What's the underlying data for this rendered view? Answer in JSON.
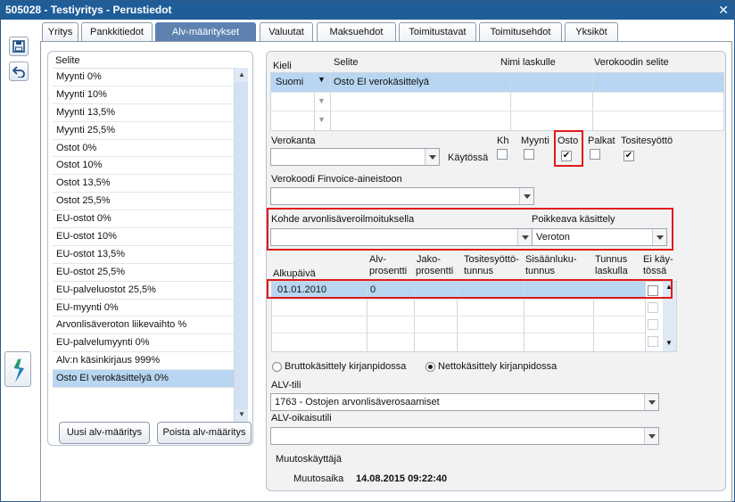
{
  "window": {
    "title": "505028 - Testiyritys - Perustiedot",
    "close_glyph": "✕"
  },
  "toolbar": {
    "save_icon": "save-icon",
    "undo_icon": "undo-icon",
    "app_icon": "app-logo-icon"
  },
  "tabs": [
    {
      "label": "Yritys"
    },
    {
      "label": "Pankkitiedot"
    },
    {
      "label": "Alv-määritykset",
      "active": true
    },
    {
      "label": "Valuutat"
    },
    {
      "label": "Maksuehdot"
    },
    {
      "label": "Toimitustavat"
    },
    {
      "label": "Toimitusehdot"
    },
    {
      "label": "Yksiköt"
    }
  ],
  "list": {
    "header": "Selite",
    "items": [
      "Myynti 0%",
      "Myynti 10%",
      "Myynti 13,5%",
      "Myynti 25,5%",
      "Ostot 0%",
      "Ostot 10%",
      "Ostot 13,5%",
      "Ostot 25,5%",
      "EU-ostot 0%",
      "EU-ostot 10%",
      "EU-ostot 13,5%",
      "EU-ostot 25,5%",
      "EU-palveluostot 25,5%",
      "EU-myynti 0%",
      "Arvonlisäveroton liikevaihto %",
      "EU-palvelumyynti 0%",
      "Alv:n käsinkirjaus 999%",
      "Osto EI verokäsittelyä 0%"
    ],
    "selected_index": 17
  },
  "buttons": {
    "new": "Uusi alv-määritys",
    "delete": "Poista alv-määritys"
  },
  "lang_grid": {
    "headers": {
      "kieli": "Kieli",
      "selite": "Selite",
      "nimi": "Nimi laskulle",
      "verokoodin": "Verokoodin selite"
    },
    "row": {
      "kieli": "Suomi",
      "selite": "Osto EI verokäsittelyä"
    }
  },
  "verokanta": {
    "label": "Verokanta",
    "value": "",
    "kaytossa": "Käytössä"
  },
  "flags": {
    "kh": {
      "label": "Kh",
      "checked": false
    },
    "myynti": {
      "label": "Myynti",
      "checked": false
    },
    "osto": {
      "label": "Osto",
      "checked": true
    },
    "palkat": {
      "label": "Palkat",
      "checked": false
    },
    "tositesyotto": {
      "label": "Tositesyöttö",
      "checked": true
    }
  },
  "finvoice": {
    "label": "Verokoodi Finvoice-aineistoon",
    "value": ""
  },
  "kohde": {
    "label": "Kohde arvonlisäveroilmoituksella",
    "value": ""
  },
  "poikkeava": {
    "label": "Poikkeava käsittely",
    "value": "Veroton"
  },
  "rate_grid": {
    "headers": {
      "alkupaiva": "Alkupäivä",
      "alv1": "Alv-",
      "alv2": "prosentti",
      "jako1": "Jako-",
      "jako2": "prosentti",
      "tos1": "Tositesyöttö-",
      "tos2": "tunnus",
      "sis1": "Sisäänluku-",
      "sis2": "tunnus",
      "tun1": "Tunnus",
      "tun2": "laskulla",
      "ei1": "Ei käy-",
      "ei2": "tössä"
    },
    "row": {
      "alkupaiva": "01.01.2010",
      "alv": "0"
    }
  },
  "kasittely": {
    "brutto": "Bruttokäsittely kirjanpidossa",
    "netto": "Nettokäsittely kirjanpidossa",
    "selected": "netto"
  },
  "alv_tili": {
    "label": "ALV-tili",
    "value": "1763 - Ostojen arvonlisäverosaamiset"
  },
  "alv_oikaisu": {
    "label": "ALV-oikaisutili",
    "value": ""
  },
  "muutos": {
    "kayttaja_label": "Muutoskäyttäjä",
    "aika_label": "Muutosaika",
    "aika_value": "14.08.2015 09:22:40"
  }
}
